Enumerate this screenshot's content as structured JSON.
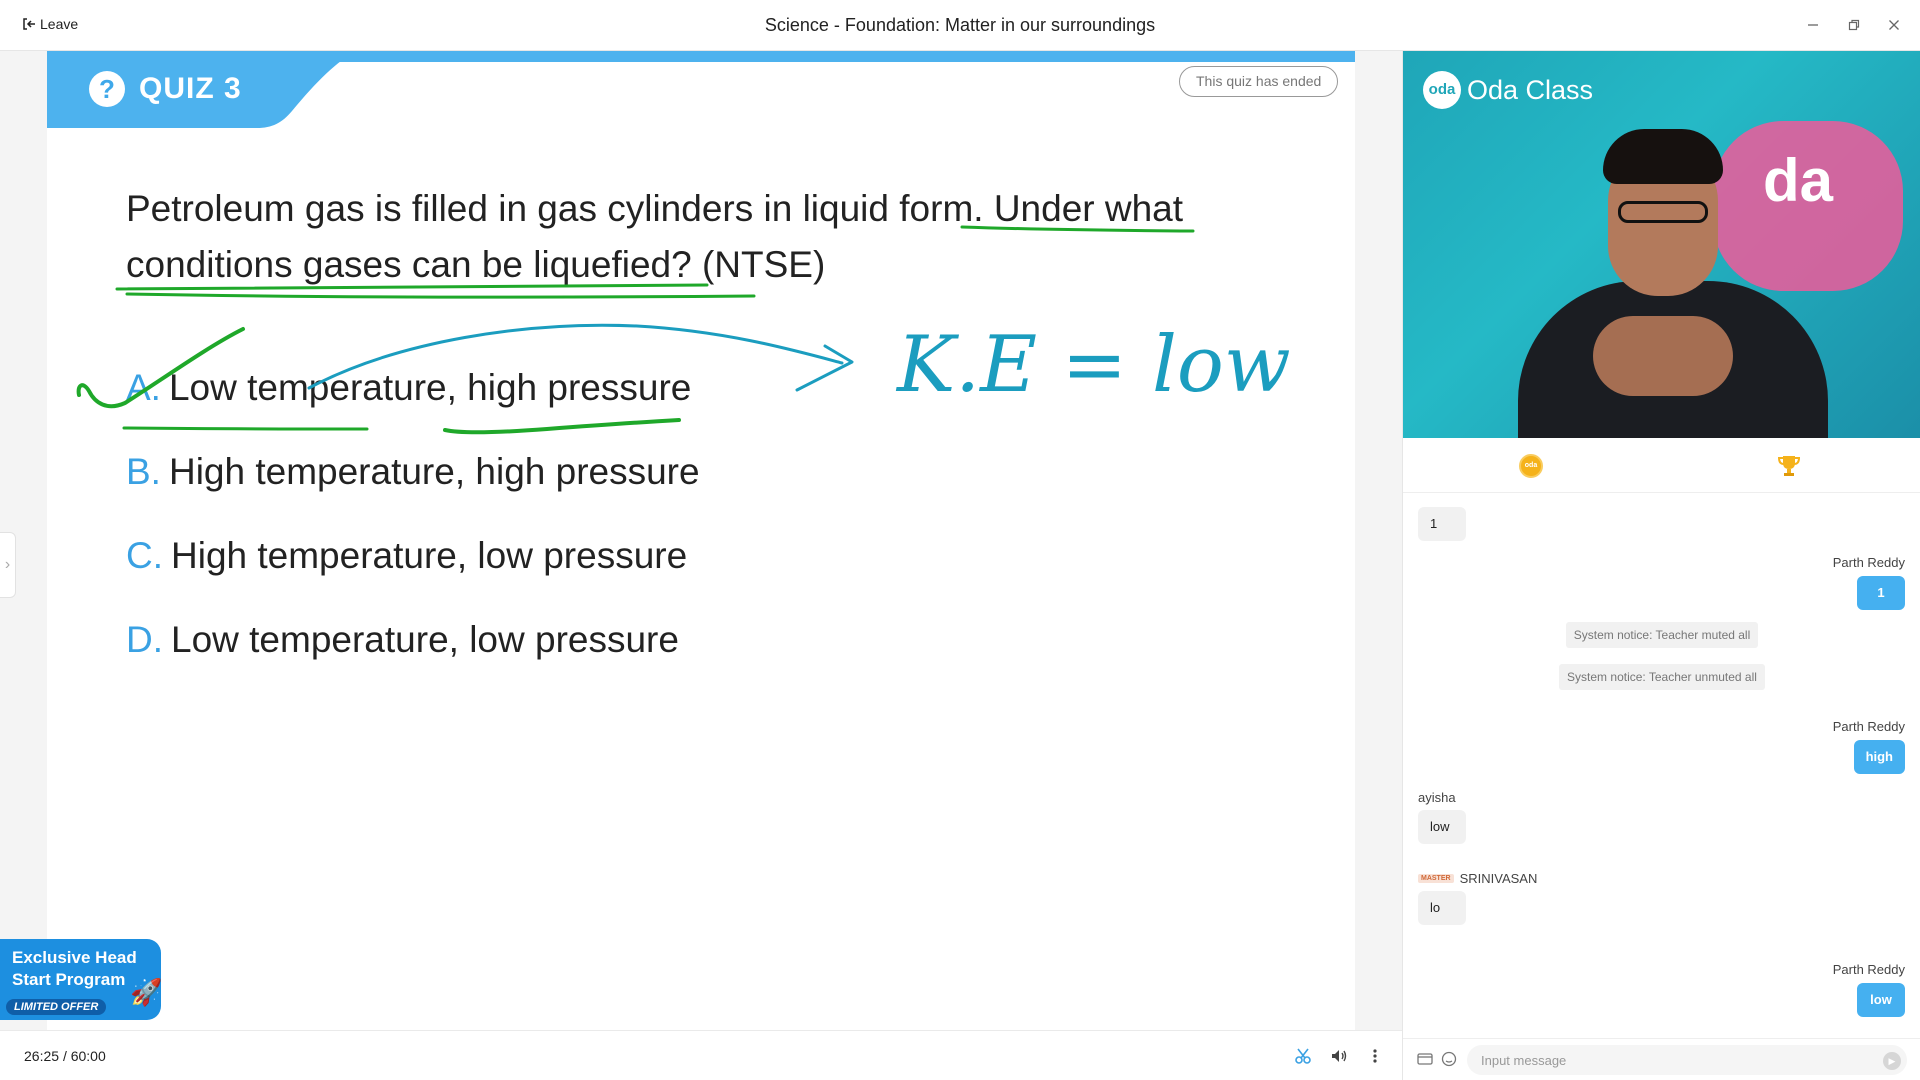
{
  "window": {
    "leave_label": "Leave",
    "title": "Science - Foundation: Matter in our surroundings",
    "controls": [
      "minimize",
      "restore",
      "close"
    ]
  },
  "quiz": {
    "label": "QUIZ 3",
    "icon_glyph": "?",
    "status": "This quiz has ended",
    "question": "Petroleum gas is filled in gas cylinders in liquid form. Under what conditions gases can be liquefied? (NTSE)",
    "options": [
      {
        "letter": "A.",
        "text": "Low temperature, high pressure"
      },
      {
        "letter": "B.",
        "text": "High temperature, high pressure"
      },
      {
        "letter": "C.",
        "text": "High temperature, low pressure"
      },
      {
        "letter": "D.",
        "text": "Low temperature, low pressure"
      }
    ],
    "handwritten_note": "K.E = low"
  },
  "promo": {
    "line1": "Exclusive Head",
    "line2": "Start Program",
    "offer": "LIMITED OFFER"
  },
  "player": {
    "elapsed": "26:25",
    "separator": "/",
    "total": "60:00"
  },
  "video": {
    "brand": "Oda Class",
    "logo_text": "oda",
    "wall_text": "da"
  },
  "panel": {
    "coin_text": "oda"
  },
  "chat": {
    "messages": [
      {
        "type": "left",
        "sender": "",
        "text": "1"
      },
      {
        "type": "right",
        "sender": "Parth Reddy",
        "text": "1"
      },
      {
        "type": "notice",
        "text": "System notice: Teacher muted all"
      },
      {
        "type": "notice",
        "text": "System notice: Teacher unmuted all"
      },
      {
        "type": "right",
        "sender": "Parth Reddy",
        "text": "high"
      },
      {
        "type": "left",
        "sender": "ayisha",
        "text": "low"
      },
      {
        "type": "left",
        "sender": "SRINIVASAN",
        "badge": "MASTER",
        "text": "lo"
      },
      {
        "type": "right",
        "sender": "Parth Reddy",
        "text": "low"
      }
    ],
    "input_placeholder": "Input message"
  },
  "colors": {
    "accent_blue": "#45b0f0",
    "quiz_header_blue": "#4db2ee",
    "option_letter_blue": "#3aa1e3",
    "annotation_green": "#1fa82a",
    "annotation_teal": "#1b9dbf"
  }
}
